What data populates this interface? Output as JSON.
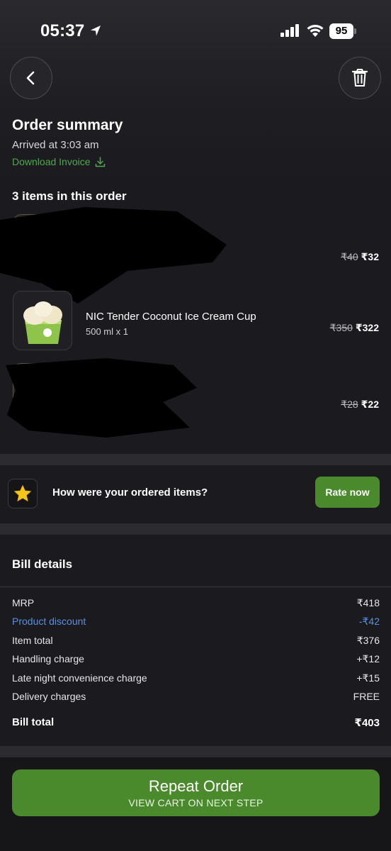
{
  "status_bar": {
    "time": "05:37",
    "battery": "95"
  },
  "header": {
    "title": "Order summary",
    "arrived": "Arrived at 3:03 am",
    "download_invoice": "Download Invoice"
  },
  "items_heading": "3 items in this order",
  "items": [
    {
      "name": "",
      "qty": "",
      "old_price": "₹40",
      "price": "₹32"
    },
    {
      "name": "NIC Tender Coconut Ice Cream Cup",
      "qty": "500 ml x 1",
      "old_price": "₹350",
      "price": "₹322"
    },
    {
      "name": "",
      "qty": "",
      "old_price": "₹28",
      "price": "₹22"
    }
  ],
  "rate": {
    "question": "How were your ordered items?",
    "button": "Rate now"
  },
  "bill": {
    "title": "Bill details",
    "rows": [
      {
        "label": "MRP",
        "value": "₹418"
      },
      {
        "label": "Product discount",
        "value": "-₹42"
      },
      {
        "label": "Item total",
        "value": "₹376"
      },
      {
        "label": "Handling charge",
        "value": "+₹12"
      },
      {
        "label": "Late night convenience charge",
        "value": "+₹15"
      },
      {
        "label": "Delivery charges",
        "value": "FREE"
      }
    ],
    "total_label": "Bill total",
    "total_value": "₹403"
  },
  "repeat": {
    "main": "Repeat Order",
    "sub": "VIEW CART ON NEXT STEP"
  },
  "colors": {
    "accent_green": "#4a8a2d",
    "invoice_green": "#4fa84a",
    "discount_blue": "#5a8fe0",
    "background": "#1b1b1f"
  }
}
